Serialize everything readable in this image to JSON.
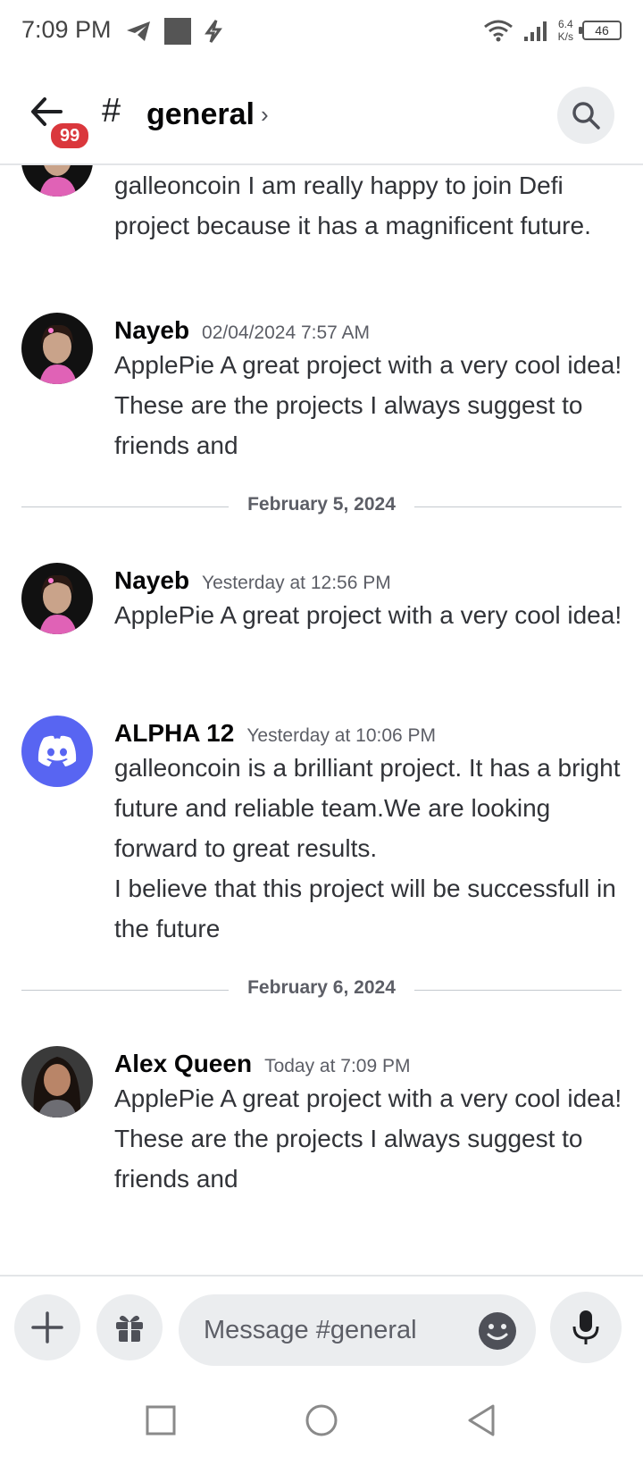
{
  "status_bar": {
    "time": "7:09 PM",
    "speed_value": "6.4",
    "speed_unit": "K/s",
    "battery": "46"
  },
  "header": {
    "badge_count": "99",
    "hash": "#",
    "channel_name": "general",
    "chevron": "›"
  },
  "messages": [
    {
      "author": "",
      "timestamp": "",
      "text": "galleoncoin  I am really happy to join Defi project because it has a magnificent future."
    },
    {
      "author": "Nayeb",
      "timestamp": "02/04/2024 7:57 AM",
      "text": "ApplePie  A great project with a very cool idea! These are the projects I always suggest to friends and"
    },
    {
      "author": "Nayeb",
      "timestamp": "Yesterday at 12:56 PM",
      "text": "ApplePie  A great project with a very cool idea!"
    },
    {
      "author": "ALPHA 12",
      "timestamp": "Yesterday at 10:06 PM",
      "text": "galleoncoin is a brilliant project. It has a bright future and reliable team.We are looking forward to great results.\nI believe that this project will be successfull in the future"
    },
    {
      "author": "Alex Queen",
      "timestamp": "Today at 7:09 PM",
      "text": "ApplePie  A great project with a very cool idea! These are the projects I always suggest to friends and"
    }
  ],
  "dividers": [
    {
      "label": "February 5, 2024"
    },
    {
      "label": "February 6, 2024"
    }
  ],
  "composer": {
    "placeholder": "Message #general"
  },
  "colors": {
    "discord_blurple": "#5865f2",
    "badge_red": "#da373c",
    "divider_line": "#c4c9ce"
  },
  "icons": {
    "back": "arrow-left-icon",
    "search": "search-icon",
    "add": "plus-icon",
    "gift": "gift-icon",
    "emoji": "emoji-icon",
    "mic": "microphone-icon",
    "discord": "discord-logo-icon"
  }
}
